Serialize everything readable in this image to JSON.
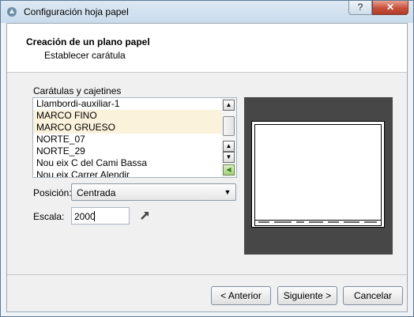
{
  "window": {
    "title": "Configuración hoja papel",
    "help_label": "?",
    "close_label": "✕"
  },
  "header": {
    "title": "Creación de un plano papel",
    "subtitle": "Establecer carátula"
  },
  "list": {
    "label": "Carátulas y cajetines",
    "items": [
      {
        "label": "Llambordi-auxiliar-1",
        "selected": false
      },
      {
        "label": "MARCO FINO",
        "selected": true
      },
      {
        "label": "MARCO GRUESO",
        "selected": true
      },
      {
        "label": "NORTE_07",
        "selected": false
      },
      {
        "label": "NORTE_29",
        "selected": false
      },
      {
        "label": "Nou eix C del Cami Bassa",
        "selected": false
      },
      {
        "label": "Nou eix Carrer Alendir",
        "selected": false
      }
    ]
  },
  "position": {
    "label": "Posición:",
    "value": "Centrada"
  },
  "scale": {
    "label": "Escala:",
    "value": "2000"
  },
  "buttons": {
    "back": "< Anterior",
    "next": "Siguiente >",
    "cancel": "Cancelar"
  },
  "colors": {
    "selection": "#fbf2dc",
    "preview_bg": "#474747"
  },
  "icons": {
    "app": "app-icon",
    "arrow": "arrow-up-right-icon"
  }
}
